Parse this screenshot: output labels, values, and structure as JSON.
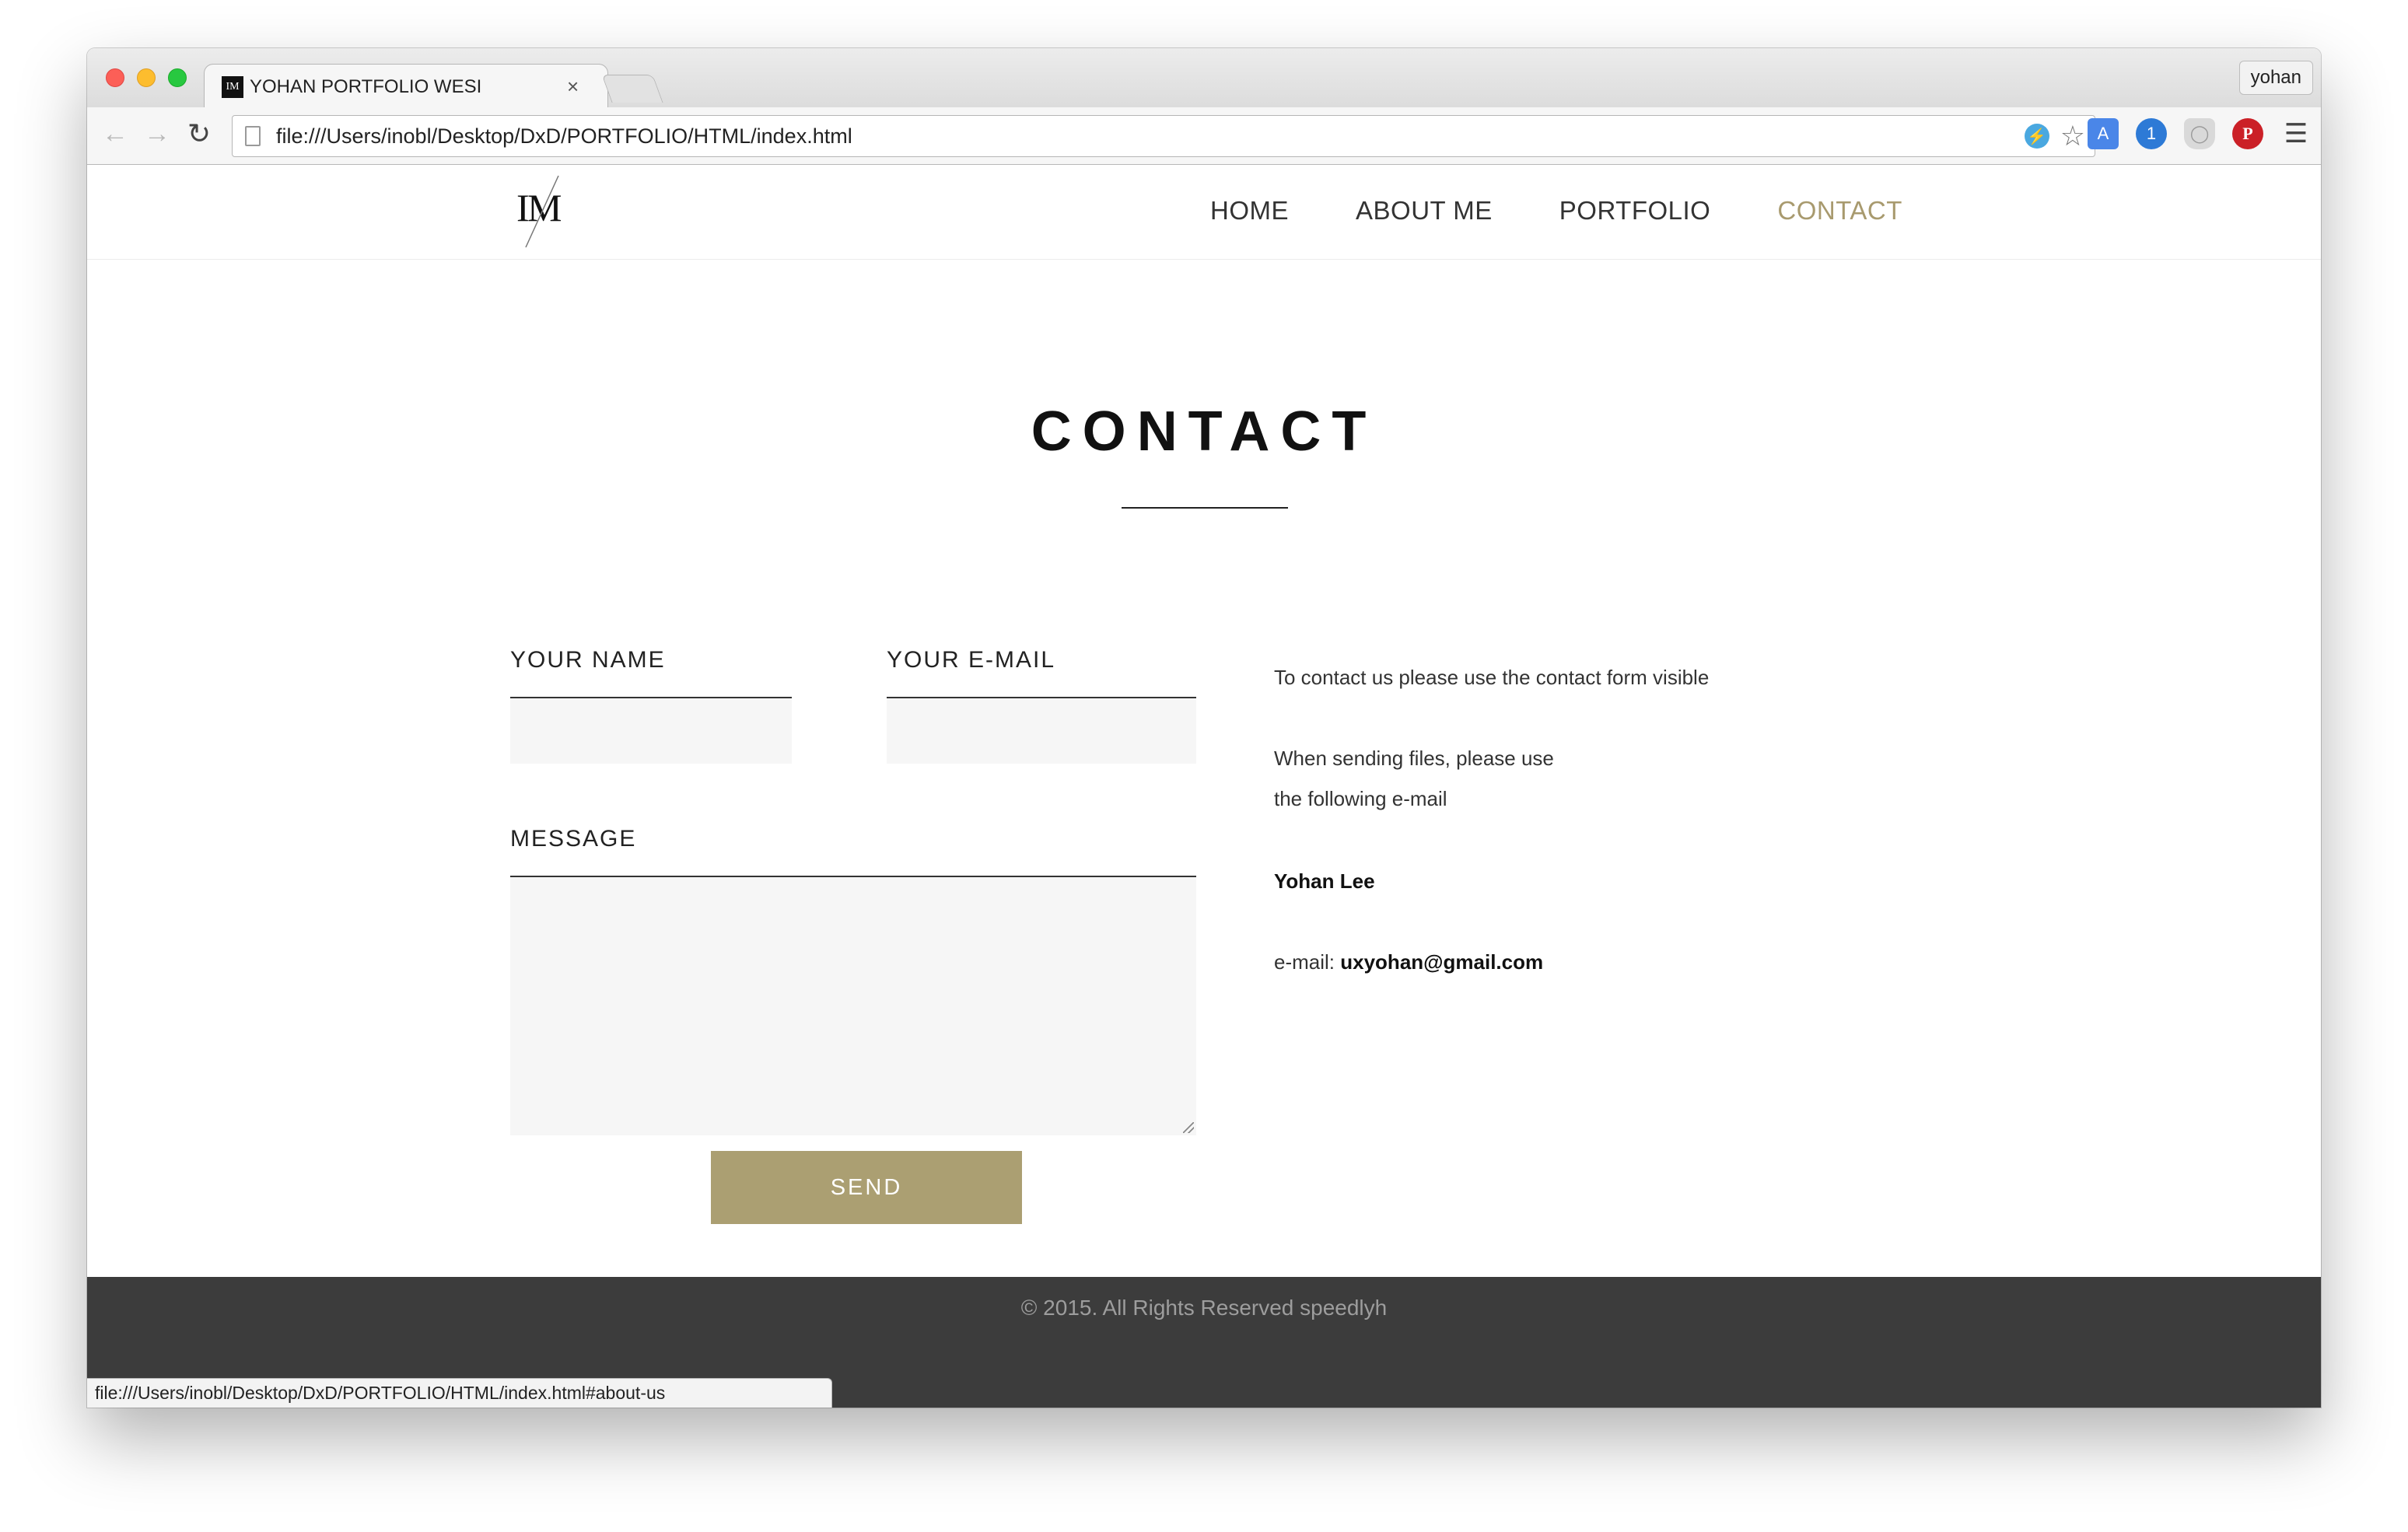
{
  "browser": {
    "tab_title": "YOHAN PORTFOLIO WESI",
    "tab_close": "×",
    "profile_name": "yohan",
    "url": "file:///Users/inobl/Desktop/DxD/PORTFOLIO/HTML/index.html",
    "status_url": "file:///Users/inobl/Desktop/DxD/PORTFOLIO/HTML/index.html#about-us",
    "icons": [
      "back-arrow-icon",
      "forward-arrow-icon",
      "reload-icon",
      "page-icon",
      "bolt-icon",
      "star-icon",
      "translate-icon",
      "onepassword-icon",
      "shield-icon",
      "pinterest-icon",
      "menu-icon"
    ]
  },
  "site": {
    "nav": [
      {
        "label": "HOME"
      },
      {
        "label": "ABOUT ME"
      },
      {
        "label": "PORTFOLIO"
      },
      {
        "label": "CONTACT",
        "active": true
      }
    ],
    "accent_color": "#ab9f72"
  },
  "contact": {
    "title": "CONTACT",
    "form": {
      "name_label": "YOUR NAME",
      "email_label": "YOUR E-MAIL",
      "message_label": "MESSAGE",
      "name_value": "",
      "email_value": "",
      "message_value": "",
      "send_label": "SEND"
    },
    "info": {
      "line1": "To contact us please use the contact form visible",
      "line2": "When sending files, please use",
      "line3": "the following e-mail",
      "name": "Yohan Lee",
      "email_prefix": "e-mail:",
      "email": "uxyohan@gmail.com"
    }
  },
  "footer": {
    "copyright": "© 2015. All Rights Reserved speedlyh",
    "background": "#3c3c3c"
  }
}
